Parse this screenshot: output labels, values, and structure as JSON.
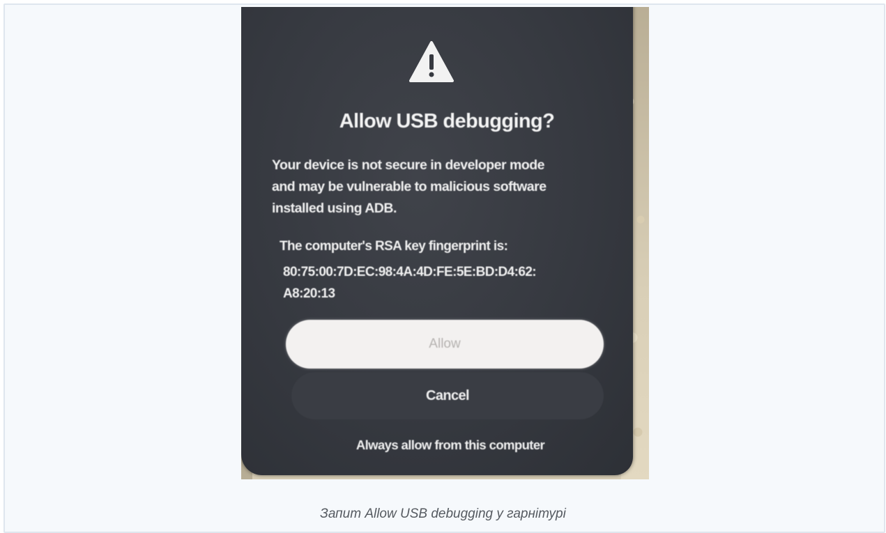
{
  "dialog": {
    "title": "Allow USB debugging?",
    "warning_text": "Your device is not secure in developer mode\nand may be vulnerable to malicious software\ninstalled using ADB.",
    "rsa_label": "The computer's RSA key fingerprint is:",
    "rsa_fingerprint": "80:75:00:7D:EC:98:4A:4D:FE:5E:BD:D4:62:\nA8:20:13",
    "allow_label": "Allow",
    "cancel_label": "Cancel",
    "always_allow_label": "Always allow from this computer",
    "icon": "warning-triangle-icon"
  },
  "caption": "Запит Allow USB debugging у гарнітурі",
  "colors": {
    "dialog_background": "#363940",
    "allow_button": "#f3f1f0",
    "cancel_button": "#3a3d44",
    "caption_text": "#555a60"
  }
}
